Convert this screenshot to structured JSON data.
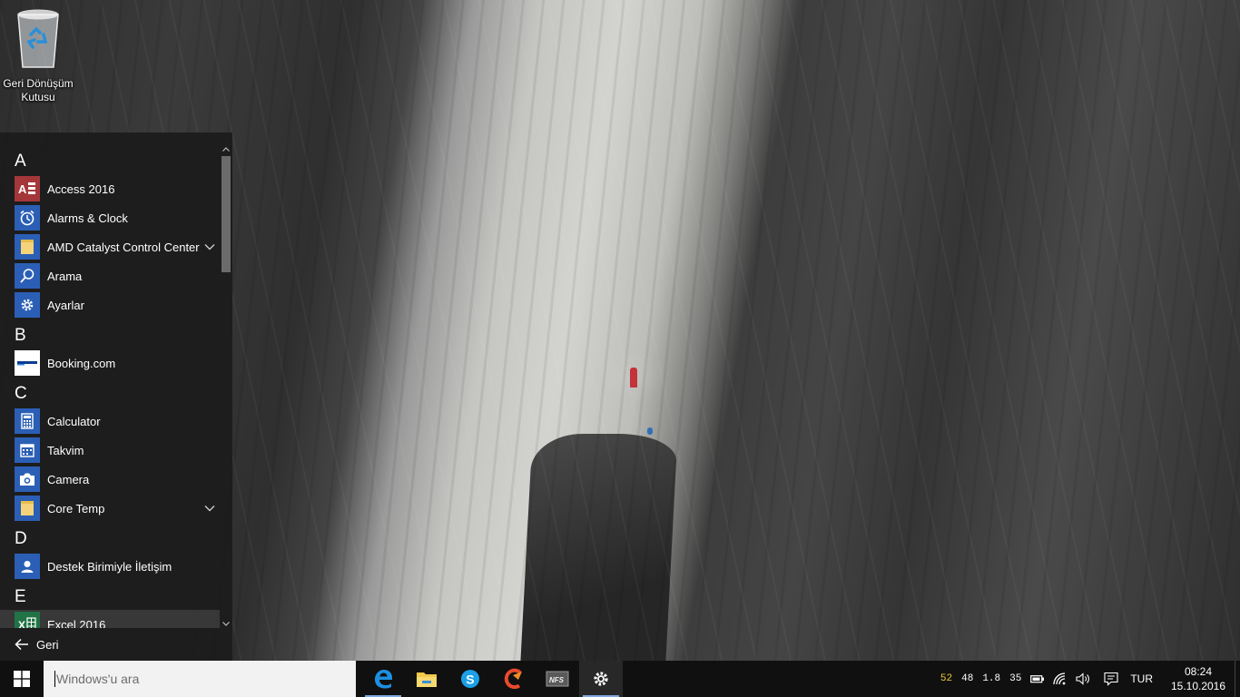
{
  "desktop": {
    "icons": [
      {
        "label": "Geri Dönüşüm Kutusu",
        "icon": "recycle-bin-icon"
      }
    ]
  },
  "start_menu": {
    "groups": [
      {
        "letter": "A",
        "apps": [
          {
            "name": "Access 2016",
            "icon": "access-icon",
            "expandable": false
          },
          {
            "name": "Alarms & Clock",
            "icon": "alarm-clock-icon",
            "expandable": false
          },
          {
            "name": "AMD Catalyst Control Center",
            "icon": "folder-icon",
            "expandable": true
          },
          {
            "name": "Arama",
            "icon": "search-icon",
            "expandable": false
          },
          {
            "name": "Ayarlar",
            "icon": "gear-icon",
            "expandable": false
          }
        ]
      },
      {
        "letter": "B",
        "apps": [
          {
            "name": "Booking.com",
            "icon": "booking-icon",
            "expandable": false
          }
        ]
      },
      {
        "letter": "C",
        "apps": [
          {
            "name": "Calculator",
            "icon": "calculator-icon",
            "expandable": false
          },
          {
            "name": "Takvim",
            "icon": "calendar-icon",
            "expandable": false
          },
          {
            "name": "Camera",
            "icon": "camera-icon",
            "expandable": false
          },
          {
            "name": "Core Temp",
            "icon": "folder-icon",
            "expandable": true
          }
        ]
      },
      {
        "letter": "D",
        "apps": [
          {
            "name": "Destek Birimiyle İletişim",
            "icon": "contact-support-icon",
            "expandable": false
          }
        ]
      },
      {
        "letter": "E",
        "apps": [
          {
            "name": "Excel 2016",
            "icon": "excel-icon",
            "expandable": false
          }
        ]
      }
    ],
    "back_label": "Geri"
  },
  "taskbar": {
    "search_placeholder": "Windows'u ara",
    "pinned": [
      {
        "name": "Microsoft Edge",
        "icon": "edge-icon",
        "running": true
      },
      {
        "name": "File Explorer",
        "icon": "file-explorer-icon",
        "running": false
      },
      {
        "name": "Skype",
        "icon": "skype-icon",
        "running": false
      },
      {
        "name": "CCleaner",
        "icon": "ccleaner-icon",
        "running": false
      },
      {
        "name": "Need for Speed",
        "icon": "nfs-icon",
        "running": false
      },
      {
        "name": "Ayarlar",
        "icon": "gear-icon",
        "running": true
      }
    ],
    "tray": {
      "temps": [
        "52",
        "48",
        "1.8",
        "35"
      ],
      "temp_highlight_color": "#f2c73a",
      "language": "TUR",
      "time": "08:24",
      "date": "15.10.2016"
    }
  },
  "colors": {
    "accent": "#2b5fb5",
    "access": "#a4373a",
    "excel": "#217346",
    "taskbar": "#101010",
    "running_indicator": "#7fa8e0"
  }
}
